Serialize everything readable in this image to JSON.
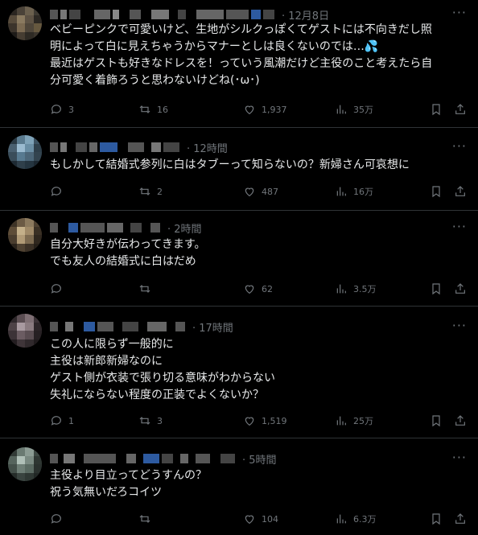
{
  "tweets": [
    {
      "time": "· 12月8日",
      "lines": [
        "ベビーピンクで可愛いけど、生地がシルクっぽくてゲストには不向きだし照",
        "明によって白に見えちゃうからマナーとしは良くないのでは…💦",
        "最近はゲストも好きなドレスを！っていう風潮だけど主役のこと考えたら自",
        "分可愛く着飾ろうと思わないけどね(･ω･)"
      ],
      "replies": "3",
      "retweets": "16",
      "likes": "1,937",
      "views": "35万"
    },
    {
      "time": "· 12時間",
      "lines": [
        "もしかして結婚式参列に白はタブーって知らないの？新婦さん可哀想に"
      ],
      "replies": "",
      "retweets": "2",
      "likes": "487",
      "views": "16万"
    },
    {
      "time": "· 2時間",
      "lines": [
        "自分大好きが伝わってきます。",
        "でも友人の結婚式に白はだめ"
      ],
      "replies": "",
      "retweets": "",
      "likes": "62",
      "views": "3.5万"
    },
    {
      "time": "· 17時間",
      "lines": [
        "この人に限らず一般的に",
        "主役は新郎新婦なのに",
        "ゲスト側が衣装で張り切る意味がわからない",
        "失礼にならない程度の正装でよくないか？"
      ],
      "replies": "1",
      "retweets": "3",
      "likes": "1,519",
      "views": "25万"
    },
    {
      "time": "· 5時間",
      "lines": [
        "主役より目立ってどうすんの？",
        "祝う気無いだろコイツ"
      ],
      "replies": "",
      "retweets": "",
      "likes": "104",
      "views": "6.3万"
    }
  ],
  "ui": {
    "more": "···"
  },
  "colors": {
    "background": "#000000",
    "text": "#e7e9ea",
    "muted": "#71767b",
    "divider": "#2f3336"
  }
}
